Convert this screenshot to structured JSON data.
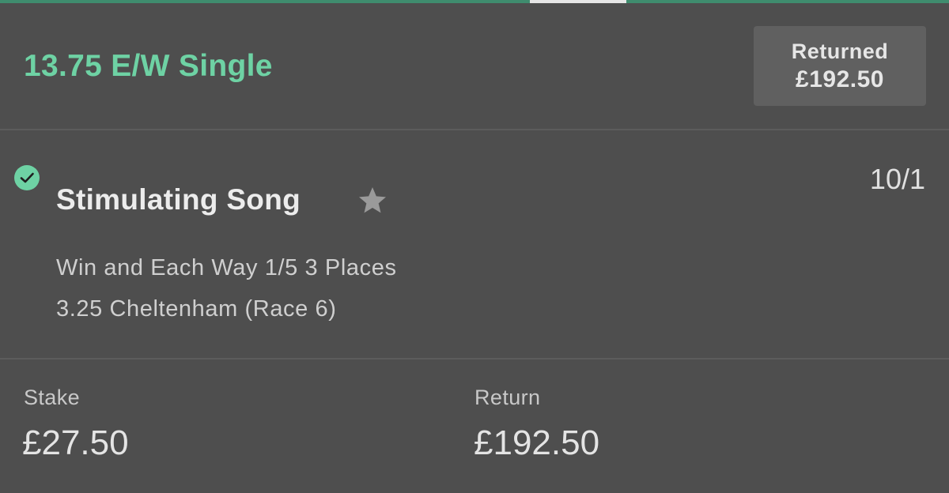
{
  "bet": {
    "title": "13.75 E/W Single",
    "returned_label": "Returned",
    "returned_value": "£192.50"
  },
  "selection": {
    "status_icon": "check-circle-icon",
    "name": "Stimulating Song",
    "favourite_icon": "star-icon",
    "odds": "10/1",
    "market": "Win and Each Way 1/5 3 Places",
    "event": "3.25 Cheltenham (Race 6)"
  },
  "summary": {
    "stake_label": "Stake",
    "stake_value": "£27.50",
    "return_label": "Return",
    "return_value": "£192.50"
  },
  "colors": {
    "background": "#4e4e4e",
    "accent_green": "#6ed2a4",
    "returned_box": "#606060",
    "top_bar": "#3f8c6e"
  }
}
